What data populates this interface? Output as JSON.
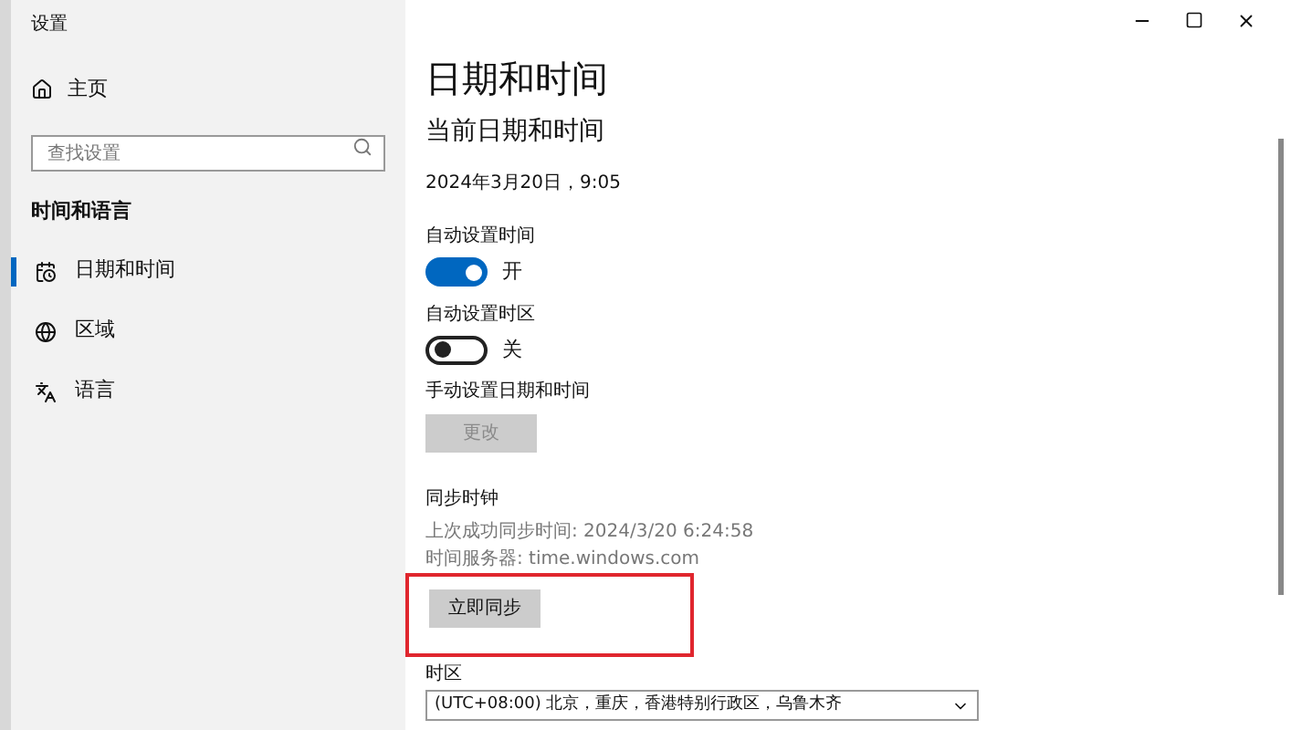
{
  "window": {
    "title": "设置"
  },
  "sidebar": {
    "home": "主页",
    "search": {
      "placeholder": "查找设置"
    },
    "section": "时间和语言",
    "items": [
      {
        "label": "日期和时间",
        "selected": true
      },
      {
        "label": "区域",
        "selected": false
      },
      {
        "label": "语言",
        "selected": false
      }
    ]
  },
  "page": {
    "title": "日期和时间",
    "subtitle": "当前日期和时间",
    "current": "2024年3月20日，9:05",
    "auto_time": {
      "label": "自动设置时间",
      "on": true,
      "state": "开"
    },
    "auto_zone": {
      "label": "自动设置时区",
      "on": false,
      "state": "关"
    },
    "manual": {
      "label": "手动设置日期和时间",
      "button": "更改",
      "disabled": true
    },
    "sync": {
      "heading": "同步时钟",
      "last": "上次成功同步时间: 2024/3/20 6:24:58",
      "server": "时间服务器: time.windows.com",
      "button": "立即同步",
      "highlighted": true
    },
    "timezone": {
      "label": "时区",
      "value": "(UTC+08:00) 北京，重庆，香港特别行政区，乌鲁木齐"
    }
  }
}
